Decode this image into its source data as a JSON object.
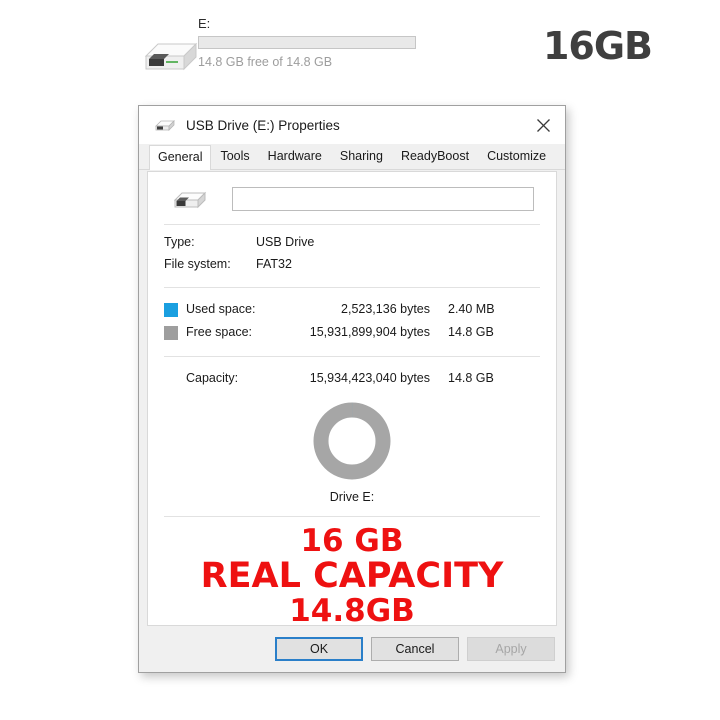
{
  "banner": {
    "drive_icon": "usb-flash-drive-icon",
    "drive_letter": "E:",
    "bar_percent": 0,
    "free_of_text": "14.8 GB free of 14.8 GB",
    "capacity_badge": "16GB"
  },
  "dialog": {
    "title_icon": "usb-flash-drive-icon",
    "title": "USB Drive (E:) Properties",
    "close_icon": "close-icon",
    "tabs": [
      {
        "label": "General",
        "active": true
      },
      {
        "label": "Tools",
        "active": false
      },
      {
        "label": "Hardware",
        "active": false
      },
      {
        "label": "Sharing",
        "active": false
      },
      {
        "label": "ReadyBoost",
        "active": false
      },
      {
        "label": "Customize",
        "active": false
      }
    ],
    "general": {
      "drive_icon": "usb-flash-drive-icon",
      "volume_label_value": "",
      "volume_label_placeholder": "",
      "type_key": "Type:",
      "type_value": "USB Drive",
      "filesystem_key": "File system:",
      "filesystem_value": "FAT32",
      "used_space": {
        "swatch_color": "#1a9fe0",
        "key": "Used space:",
        "bytes": "2,523,136 bytes",
        "human": "2.40 MB"
      },
      "free_space": {
        "swatch_color": "#9e9e9e",
        "key": "Free space:",
        "bytes": "15,931,899,904 bytes",
        "human": "14.8 GB"
      },
      "capacity": {
        "key": "Capacity:",
        "bytes": "15,934,423,040 bytes",
        "human": "14.8 GB"
      },
      "drive_caption": "Drive E:"
    },
    "annotation": {
      "color": "#ee1111",
      "line1": "16 GB",
      "line2": "REAL CAPACITY",
      "line3": "14.8GB"
    },
    "buttons": {
      "ok": "OK",
      "cancel": "Cancel",
      "apply": "Apply"
    }
  },
  "chart_data": {
    "type": "pie",
    "title": "Drive E:",
    "categories": [
      "Used space",
      "Free space"
    ],
    "values": [
      2523136,
      15931899904
    ],
    "value_unit": "bytes",
    "percentages": [
      0.016,
      99.984
    ],
    "colors": [
      "#1a9fe0",
      "#a6a6a6"
    ],
    "legend": "left",
    "total": 15934423040
  }
}
